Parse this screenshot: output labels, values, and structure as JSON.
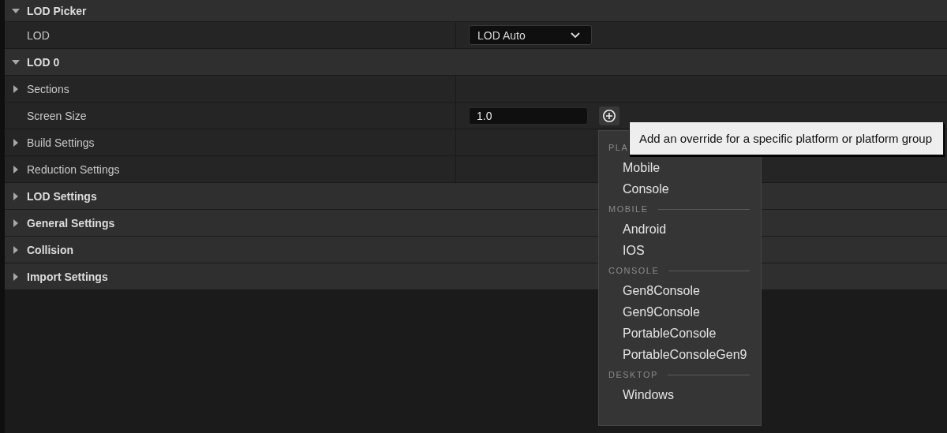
{
  "rows": [
    {
      "kind": "category",
      "label": "LOD Picker",
      "expanded": true,
      "children": [
        {
          "kind": "property",
          "label": "LOD",
          "value": {
            "kind": "dropdown",
            "text": "LOD Auto"
          }
        }
      ]
    },
    {
      "kind": "category",
      "label": "LOD 0",
      "expanded": true,
      "children": [
        {
          "kind": "property",
          "label": "Sections",
          "expanded": false
        },
        {
          "kind": "property",
          "label": "Screen Size",
          "value": {
            "kind": "number",
            "text": "1.0"
          }
        },
        {
          "kind": "property",
          "label": "Build Settings",
          "expanded": false
        },
        {
          "kind": "property",
          "label": "Reduction Settings",
          "expanded": false
        }
      ]
    },
    {
      "kind": "category",
      "label": "LOD Settings",
      "expanded": false
    },
    {
      "kind": "category",
      "label": "General Settings",
      "expanded": false
    },
    {
      "kind": "category",
      "label": "Collision",
      "expanded": false
    },
    {
      "kind": "category",
      "label": "Import Settings",
      "expanded": false
    }
  ],
  "platform_menu": {
    "sections": [
      {
        "header": "PLA",
        "items": [
          "Mobile",
          "Console"
        ]
      },
      {
        "header": "MOBILE",
        "items": [
          "Android",
          "IOS"
        ]
      },
      {
        "header": "CONSOLE",
        "items": [
          "Gen8Console",
          "Gen9Console",
          "PortableConsole",
          "PortableConsoleGen9"
        ]
      },
      {
        "header": "DESKTOP",
        "items": [
          "Windows"
        ]
      }
    ]
  },
  "tooltip": {
    "text": "Add an override for a specific platform or platform group"
  }
}
